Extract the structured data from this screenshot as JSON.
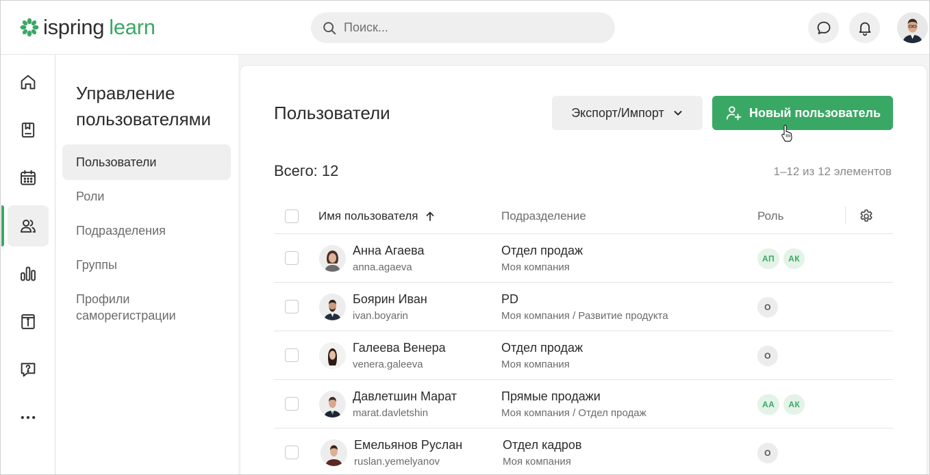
{
  "header": {
    "logo_part1": "ispring",
    "logo_part2": "learn",
    "search_placeholder": "Поиск..."
  },
  "subnav": {
    "title": "Управление пользователями",
    "items": [
      {
        "label": "Пользователи",
        "active": true
      },
      {
        "label": "Роли"
      },
      {
        "label": "Подразделения"
      },
      {
        "label": "Группы"
      },
      {
        "label": "Профили саморегистрации"
      }
    ]
  },
  "main": {
    "title": "Пользователи",
    "export_label": "Экспорт/Импорт",
    "new_user_label": "Новый пользователь",
    "total": "Всего: 12",
    "pager": "1–12 из 12 элементов",
    "columns": {
      "user": "Имя пользователя",
      "department": "Подразделение",
      "role": "Роль"
    },
    "rows": [
      {
        "name": "Анна Агаева",
        "login": "anna.agaeva",
        "dept": "Отдел продаж",
        "path": "Моя компания",
        "badges": [
          "АП",
          "АК"
        ]
      },
      {
        "name": "Боярин Иван",
        "login": "ivan.boyarin",
        "dept": "PD",
        "path": "Моя компания / Развитие продукта",
        "badges": [
          "О"
        ]
      },
      {
        "name": "Галеева Венера",
        "login": "venera.galeeva",
        "dept": "Отдел продаж",
        "path": "Моя компания",
        "badges": [
          "О"
        ]
      },
      {
        "name": "Давлетшин Марат",
        "login": "marat.davletshin",
        "dept": "Прямые продажи",
        "path": "Моя компания / Отдел продаж",
        "badges": [
          "АА",
          "АК"
        ]
      },
      {
        "name": "Емельянов Руслан",
        "login": "ruslan.yemelyanov",
        "dept": "Отдел кадров",
        "path": "Моя компания",
        "badges": [
          "О"
        ]
      }
    ]
  },
  "colors": {
    "accent": "#3aa865",
    "badge_green_bg": "#e3f3e8",
    "badge_grey_bg": "#ececec"
  }
}
